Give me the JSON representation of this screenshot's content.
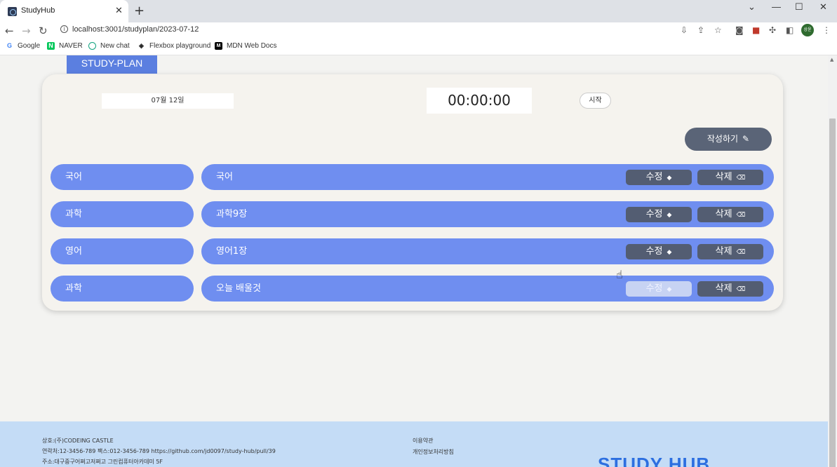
{
  "browser": {
    "tab_title": "StudyHub",
    "tab_close": "✕",
    "new_tab": "+",
    "url": "localhost:3001/studyplan/2023-07-12",
    "profile_initials": "상윤",
    "window_controls": [
      "⌄",
      "—",
      "☐",
      "✕"
    ],
    "bookmarks": [
      {
        "label": "Google",
        "icon": "google-icon",
        "color": "#4285f4"
      },
      {
        "label": "NAVER",
        "icon": "naver-icon",
        "color": "#03c75a"
      },
      {
        "label": "New chat",
        "icon": "chatgpt-icon",
        "color": "#10a37f"
      },
      {
        "label": "Flexbox playground",
        "icon": "codepen-icon",
        "color": "#222222"
      },
      {
        "label": "MDN Web Docs",
        "icon": "mdn-icon",
        "color": "#000000"
      }
    ]
  },
  "page": {
    "section_tab": "STUDY-PLAN",
    "date_label": "07월 12일",
    "timer": "00:00:00",
    "start_label": "시작",
    "write_label": "작성하기",
    "rows": [
      {
        "subject": "국어",
        "content": "국어",
        "edit": "수정",
        "delete": "삭제"
      },
      {
        "subject": "과학",
        "content": "과학9장",
        "edit": "수정",
        "delete": "삭제"
      },
      {
        "subject": "영어",
        "content": "영어1장",
        "edit": "수정",
        "delete": "삭제"
      },
      {
        "subject": "과학",
        "content": "오늘 배울것",
        "edit": "수정",
        "delete": "삭제"
      }
    ]
  },
  "footer": {
    "company": "상호:(주)CODEING CASTLE",
    "contact": "연락처:12-3456-789   팩스:012-3456-789   https://github.com/jd0097/study-hub/pull/39",
    "address": "주소:대구중구어쩌고저쩌고 그린컴퓨터아카데미 5F",
    "terms": "이용약관",
    "privacy": "개인정보처리방침",
    "logo": "STUDY HUB"
  },
  "colors": {
    "accent": "#6f8ef0",
    "button_dark": "#535d72",
    "footer_bg": "#c4dcf6"
  }
}
